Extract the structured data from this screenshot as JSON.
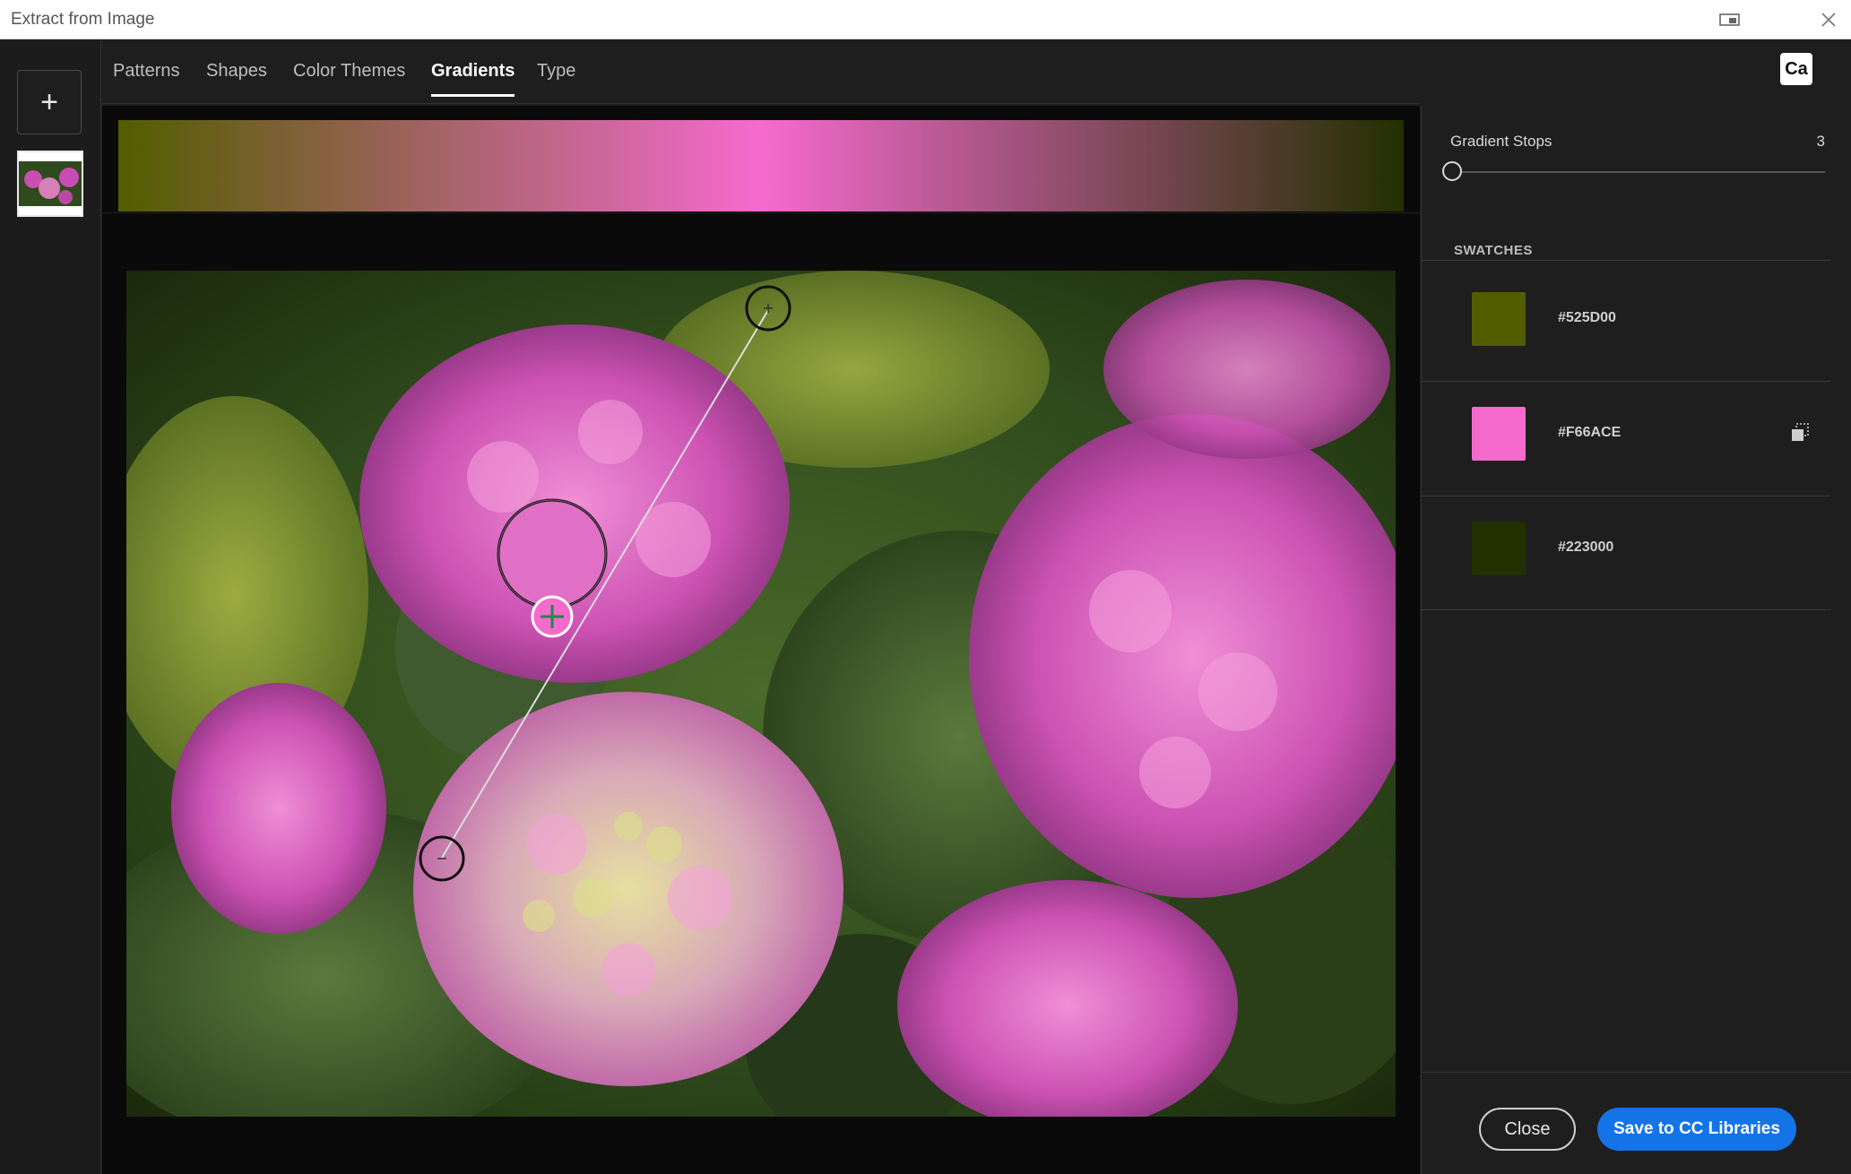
{
  "window": {
    "title": "Extract from Image"
  },
  "tabs": [
    {
      "label": "Patterns"
    },
    {
      "label": "Shapes"
    },
    {
      "label": "Color Themes"
    },
    {
      "label": "Gradients",
      "active": true
    },
    {
      "label": "Type"
    }
  ],
  "app_badge": "Ca",
  "left_rail": {
    "add_label": "+"
  },
  "gradient_stops": {
    "label": "Gradient Stops",
    "value": "3"
  },
  "swatches": {
    "heading": "SWATCHES",
    "items": [
      {
        "hex": "#525D00",
        "color": "#525D00"
      },
      {
        "hex": "#F66ACE",
        "color": "#F66ACE"
      },
      {
        "hex": "#223000",
        "color": "#223000"
      }
    ]
  },
  "buttons": {
    "close": "Close",
    "save": "Save to CC Libraries"
  },
  "icons": {
    "restore": "restore-window-icon",
    "close": "close-icon",
    "add": "plus-icon",
    "copy": "copy-icon"
  }
}
